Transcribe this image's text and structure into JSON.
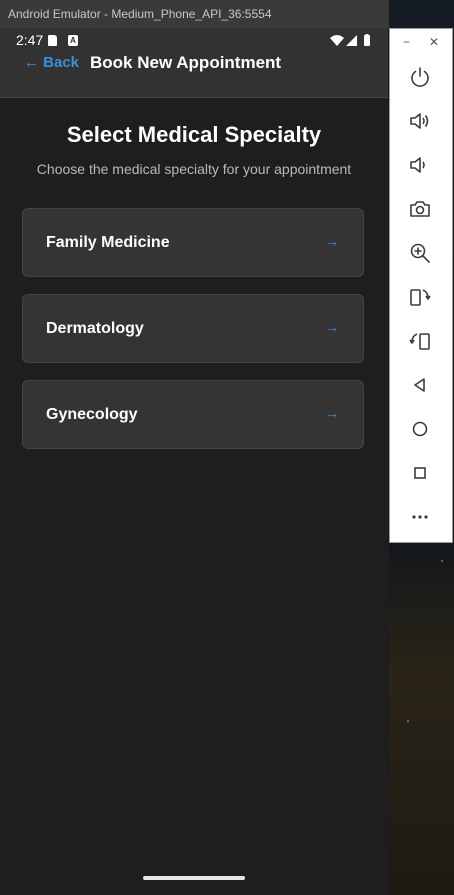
{
  "window": {
    "title": "Android Emulator - Medium_Phone_API_36:5554"
  },
  "status_bar": {
    "time": "2:47",
    "a_icon_letter": "A",
    "icons": [
      "sd-card-icon",
      "a-icon",
      "wifi-icon",
      "signal-icon",
      "battery-icon"
    ]
  },
  "header": {
    "back_label": "← Back",
    "title": "Book New Appointment"
  },
  "main": {
    "title": "Select Medical Specialty",
    "subtitle": "Choose the medical specialty for your appointment",
    "specialties": [
      {
        "label": "Family Medicine",
        "arrow": "→"
      },
      {
        "label": "Dermatology",
        "arrow": "→"
      },
      {
        "label": "Gynecology",
        "arrow": "→"
      }
    ]
  },
  "emulator_toolbar": {
    "minimize": "−",
    "close": "✕",
    "buttons": [
      "power-icon",
      "volume-up-icon",
      "volume-down-icon",
      "camera-icon",
      "zoom-icon",
      "rotate-left-icon",
      "rotate-right-icon",
      "back-icon",
      "home-icon",
      "overview-icon",
      "more-icon"
    ]
  },
  "colors": {
    "accent": "#3a8fd6",
    "background": "#1e1e1e",
    "header": "#323232",
    "card": "#343434"
  }
}
